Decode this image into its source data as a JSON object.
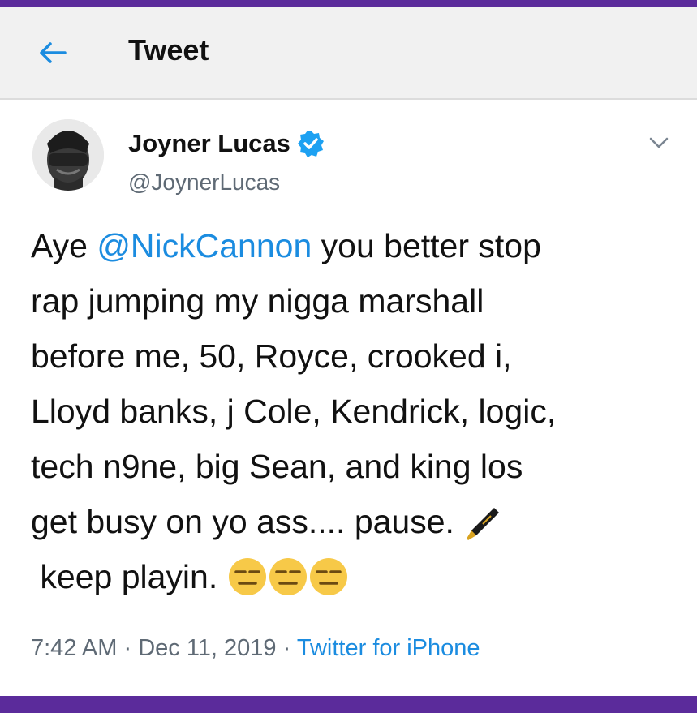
{
  "header": {
    "title": "Tweet",
    "back_icon": "arrow-left-icon"
  },
  "tweet": {
    "author_name": "Joyner Lucas",
    "author_handle": "@JoynerLucas",
    "verified": true,
    "text_line_1_prefix": "Aye ",
    "mention": "@NickCannon",
    "text_line_1_suffix": " you better stop",
    "text_line_2": "rap jumping my nigga marshall",
    "text_line_3": "before me, 50, Royce, crooked i,",
    "text_line_4": "Lloyd banks, j Cole, Kendrick, logic,",
    "text_line_5": "tech n9ne, big Sean, and king los",
    "text_line_6": "get busy on yo ass.... pause.",
    "text_line_7": " keep playin.",
    "emojis": [
      "fountain-pen-emoji",
      "expressionless-face-emoji",
      "expressionless-face-emoji",
      "expressionless-face-emoji"
    ],
    "time": "7:42 AM",
    "date": "Dec 11, 2019",
    "separator": "·",
    "source": "Twitter for iPhone"
  },
  "colors": {
    "frame": "#5b2b9b",
    "link": "#1b8ce0",
    "verified": "#1da1f2",
    "muted": "#5f6a75"
  }
}
